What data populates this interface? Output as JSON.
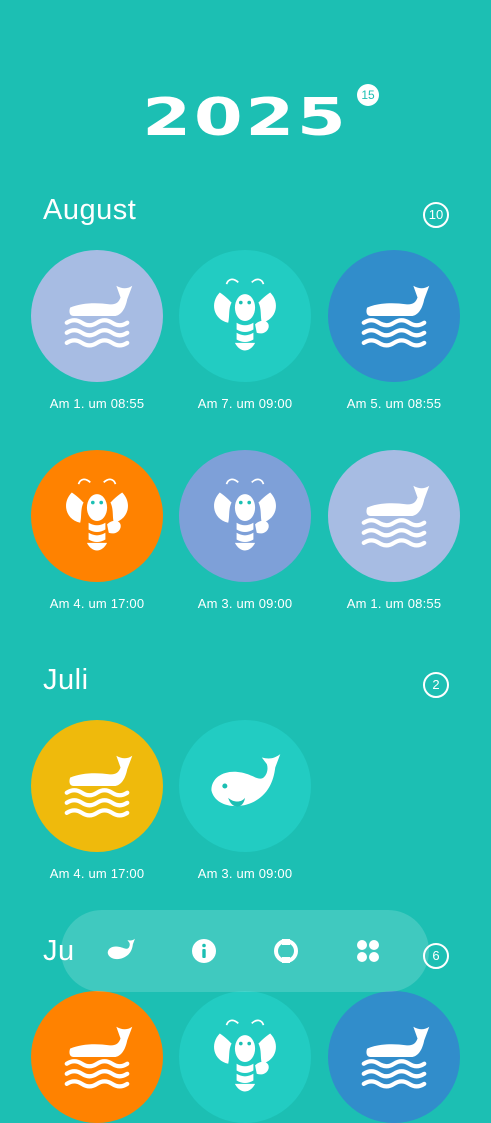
{
  "year": {
    "title": "2025",
    "badge": "15"
  },
  "colors": {
    "background": "#1CBFB3",
    "lavender": "#A7BCE3",
    "teal": "#22CCC2",
    "blue": "#318DCB",
    "orange": "#FF8200",
    "periwinkle": "#7EA0D8",
    "yellow": "#EFBA0C"
  },
  "sections": [
    {
      "month": "August",
      "count": "10",
      "items": [
        {
          "icon": "whale-waves-icon",
          "color": "lavender",
          "caption": "Am 1. um 08:55"
        },
        {
          "icon": "lobster-icon",
          "color": "teal",
          "caption": "Am 7. um 09:00"
        },
        {
          "icon": "whale-waves-icon",
          "color": "blue",
          "caption": "Am 5. um 08:55"
        },
        {
          "icon": "lobster-icon",
          "color": "orange",
          "caption": "Am 4. um 17:00"
        },
        {
          "icon": "lobster-icon",
          "color": "periwinkle",
          "caption": "Am 3. um 09:00"
        },
        {
          "icon": "whale-waves-icon",
          "color": "lavender",
          "caption": "Am 1. um 08:55"
        }
      ]
    },
    {
      "month": "Juli",
      "count": "2",
      "items": [
        {
          "icon": "whale-waves-icon",
          "color": "yellow",
          "caption": "Am 4. um 17:00"
        },
        {
          "icon": "whale-icon",
          "color": "teal",
          "caption": "Am 3. um 09:00"
        }
      ]
    },
    {
      "month": "Ju",
      "count": "6",
      "items": [
        {
          "icon": "whale-waves-icon",
          "color": "orange",
          "caption": ""
        },
        {
          "icon": "lobster-icon",
          "color": "teal",
          "caption": ""
        },
        {
          "icon": "whale-waves-icon",
          "color": "blue",
          "caption": ""
        }
      ]
    }
  ],
  "nav": [
    {
      "icon": "whale-nav-icon"
    },
    {
      "icon": "info-icon"
    },
    {
      "icon": "lifebuoy-icon"
    },
    {
      "icon": "grid-icon"
    }
  ]
}
